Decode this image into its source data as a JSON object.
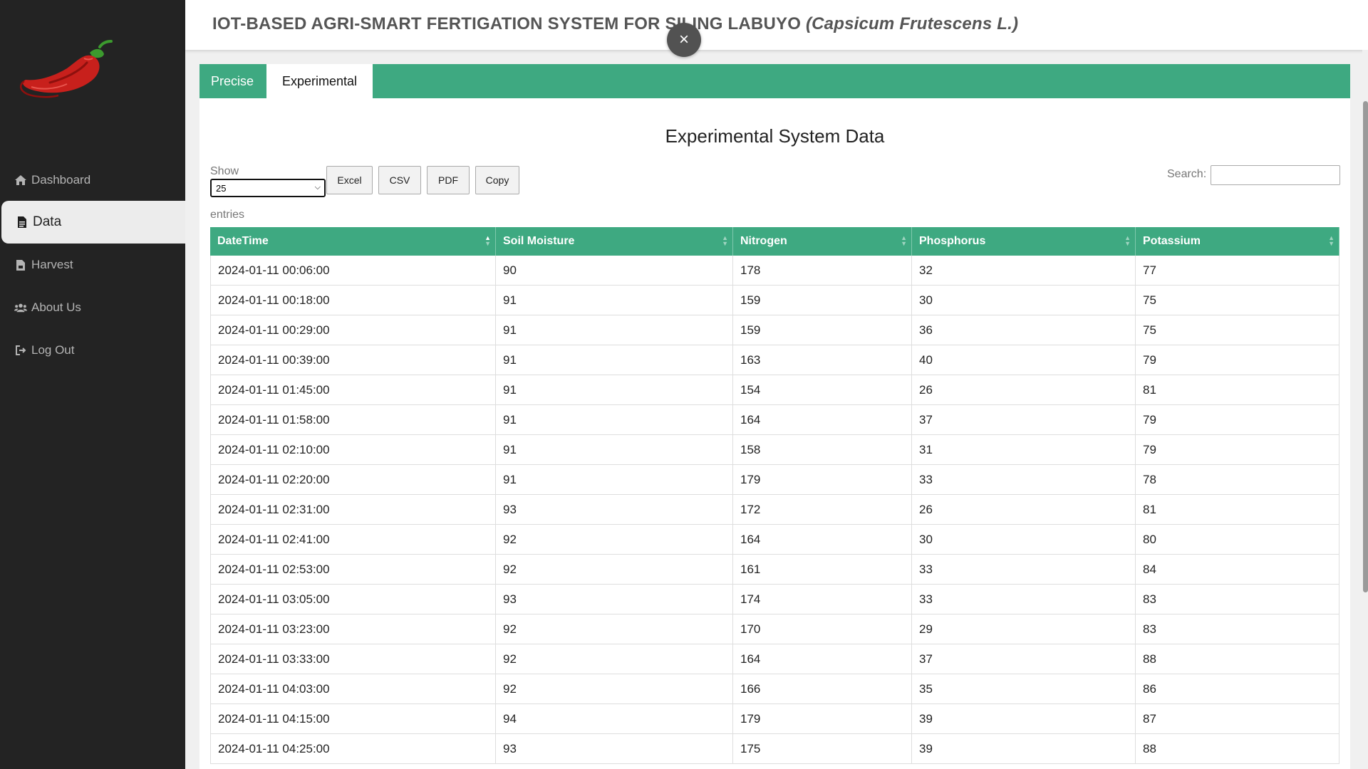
{
  "header": {
    "title_main": "IOT-BASED AGRI-SMART FERTIGATION SYSTEM FOR SILING LABUYO",
    "title_sci": "(Capsicum Frutescens L.)"
  },
  "close_symbol": "×",
  "sidebar": {
    "items": [
      {
        "label": "Dashboard",
        "icon": "home-icon"
      },
      {
        "label": "Data",
        "icon": "document-icon"
      },
      {
        "label": "Harvest",
        "icon": "file-icon"
      },
      {
        "label": "About Us",
        "icon": "users-icon"
      },
      {
        "label": "Log Out",
        "icon": "logout-icon"
      }
    ]
  },
  "tabs": [
    {
      "label": "Precise"
    },
    {
      "label": "Experimental"
    }
  ],
  "section_title": "Experimental System Data",
  "controls": {
    "show_label": "Show",
    "show_value": "25",
    "entries_label": "entries",
    "buttons": [
      "Excel",
      "CSV",
      "PDF",
      "Copy"
    ],
    "search_label": "Search:",
    "search_value": ""
  },
  "table": {
    "headers": [
      "DateTime",
      "Soil Moisture",
      "Nitrogen",
      "Phosphorus",
      "Potassium"
    ],
    "rows": [
      [
        "2024-01-11 00:06:00",
        "90",
        "178",
        "32",
        "77"
      ],
      [
        "2024-01-11 00:18:00",
        "91",
        "159",
        "30",
        "75"
      ],
      [
        "2024-01-11 00:29:00",
        "91",
        "159",
        "36",
        "75"
      ],
      [
        "2024-01-11 00:39:00",
        "91",
        "163",
        "40",
        "79"
      ],
      [
        "2024-01-11 01:45:00",
        "91",
        "154",
        "26",
        "81"
      ],
      [
        "2024-01-11 01:58:00",
        "91",
        "164",
        "37",
        "79"
      ],
      [
        "2024-01-11 02:10:00",
        "91",
        "158",
        "31",
        "79"
      ],
      [
        "2024-01-11 02:20:00",
        "91",
        "179",
        "33",
        "78"
      ],
      [
        "2024-01-11 02:31:00",
        "93",
        "172",
        "26",
        "81"
      ],
      [
        "2024-01-11 02:41:00",
        "92",
        "164",
        "30",
        "80"
      ],
      [
        "2024-01-11 02:53:00",
        "92",
        "161",
        "33",
        "84"
      ],
      [
        "2024-01-11 03:05:00",
        "93",
        "174",
        "33",
        "83"
      ],
      [
        "2024-01-11 03:23:00",
        "92",
        "170",
        "29",
        "83"
      ],
      [
        "2024-01-11 03:33:00",
        "92",
        "164",
        "37",
        "88"
      ],
      [
        "2024-01-11 04:03:00",
        "92",
        "166",
        "35",
        "86"
      ],
      [
        "2024-01-11 04:15:00",
        "94",
        "179",
        "39",
        "87"
      ],
      [
        "2024-01-11 04:25:00",
        "93",
        "175",
        "39",
        "88"
      ]
    ]
  },
  "colors": {
    "accent": "#3ea981",
    "sidebar_bg": "#232323",
    "close_button": "#525252",
    "chili_red": "#c8201c",
    "stem_green": "#3c9a2e"
  }
}
